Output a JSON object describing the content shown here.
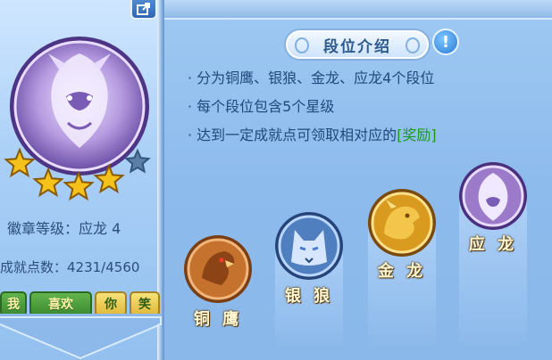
{
  "left_panel": {
    "badge_level": "徽章等级：应龙 4",
    "points": "成就点数：4231/4560",
    "stars_filled": 4,
    "stars_total": 5,
    "emotes": [
      {
        "label": "我",
        "style": "green"
      },
      {
        "label": "喜欢",
        "style": "green"
      },
      {
        "label": "你",
        "style": "yellow"
      },
      {
        "label": "笑",
        "style": "yellow"
      }
    ],
    "emblem_icon": "purple-dragon-emblem",
    "share_icon": "share-icon"
  },
  "intro": {
    "title": "段位介绍",
    "info_icon": "exclamation-icon",
    "bullets": [
      {
        "text": "· 分为铜鹰、银狼、金龙、应龙4个段位",
        "highlight": ""
      },
      {
        "text": "· 每个段位包含5个星级",
        "highlight": ""
      },
      {
        "text": "· 达到一定成就点可领取相对应的",
        "highlight": "[奖励]"
      }
    ]
  },
  "ranks": [
    {
      "label": "铜 鹰",
      "icon": "bronze-eagle-icon",
      "color": "#c5722f"
    },
    {
      "label": "银 狼",
      "icon": "silver-wolf-icon",
      "color": "#4f7fbf"
    },
    {
      "label": "金 龙",
      "icon": "gold-dragon-icon",
      "color": "#d89a1f"
    },
    {
      "label": "应 龙",
      "icon": "purple-dragon-icon",
      "color": "#9a7ac9"
    }
  ],
  "colors": {
    "panel_blue": "#93c0ef",
    "text_blue": "#1f4a7a",
    "reward_green": "#1d9a1d",
    "star_gold": "#f5c21b"
  }
}
